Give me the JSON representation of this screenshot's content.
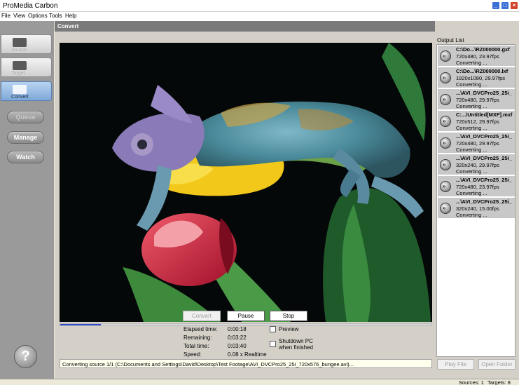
{
  "window": {
    "title": "ProMedia Carbon"
  },
  "menu": [
    "File",
    "View",
    "Options",
    "Tools",
    "Help"
  ],
  "sidebar": {
    "tabs": [
      {
        "label": "Source",
        "icon": "folder-icon",
        "active": false
      },
      {
        "label": "Target",
        "icon": "target-folder-icon",
        "active": false
      },
      {
        "label": "Convert",
        "icon": "convert-icon",
        "active": true
      }
    ],
    "buttons": [
      {
        "label": "Queue",
        "enabled": false
      },
      {
        "label": "Manage",
        "enabled": true
      },
      {
        "label": "Watch",
        "enabled": true
      }
    ],
    "help_label": "?"
  },
  "panel": {
    "title": "Convert"
  },
  "progress": {
    "fraction": 0.11
  },
  "controls": {
    "convert_label": "Convert",
    "pause_label": "Pause",
    "stop_label": "Stop"
  },
  "stats": [
    {
      "label": "Elapsed time:",
      "value": "0:00:18"
    },
    {
      "label": "Remaining:",
      "value": "0:03:22"
    },
    {
      "label": "Total time:",
      "value": "0:03:40"
    },
    {
      "label": "Speed:",
      "value": "0.08 x Realtime"
    }
  ],
  "options": {
    "preview_label": "Preview",
    "shutdown_label_1": "Shutdown PC",
    "shutdown_label_2": "when finished"
  },
  "status_message": "Converting source 1/1 (C:\\Documents and Settings\\David\\Desktop\\Test Footage\\AVI_DVCPro25_25i_720x576_bungee.avi)...",
  "output": {
    "title": "Output List",
    "items": [
      {
        "name": "C:\\Do...\\RZ000000.gxf",
        "info": "720x480, 23.97fps",
        "status": "Converting ..."
      },
      {
        "name": "C:\\Do...\\RZ000000.lxf",
        "info": "1920x1080, 29.97fps",
        "status": "Converting ..."
      },
      {
        "name": "...\\AVI_DVCPro25_25i_",
        "info": "720x480, 29.97fps",
        "status": "Converting ..."
      },
      {
        "name": "C:...\\Untitled[MXF].mxf",
        "info": "720x512, 29.97fps",
        "status": "Converting ..."
      },
      {
        "name": "...\\AVI_DVCPro25_25i_",
        "info": "720x480, 29.97fps",
        "status": "Converting ..."
      },
      {
        "name": "...\\AVI_DVCPro25_25i_",
        "info": "320x240, 29.97fps",
        "status": "Converting ..."
      },
      {
        "name": "...\\AVI_DVCPro25_25i_",
        "info": "720x480, 23.97fps",
        "status": "Converting ..."
      },
      {
        "name": "...\\AVI_DVCPro25_25i_",
        "info": "320x240, 15.00fps",
        "status": "Converting ..."
      }
    ],
    "play_file_label": "Play File",
    "open_folder_label": "Open Folder"
  },
  "statusbar": {
    "sources": "Sources: 1",
    "targets": "Targets: 8"
  }
}
